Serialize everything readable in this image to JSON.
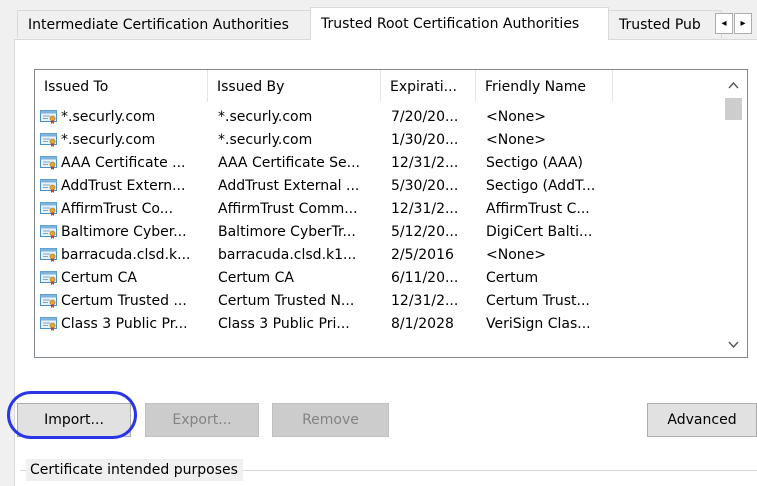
{
  "tabs": [
    {
      "label": "Intermediate Certification Authorities",
      "active": false
    },
    {
      "label": "Trusted Root Certification Authorities",
      "active": true
    },
    {
      "label": "Trusted Pub",
      "active": false
    }
  ],
  "tab_scroll": {
    "left": "◂",
    "right": "▸"
  },
  "list": {
    "columns": [
      "Issued To",
      "Issued By",
      "Expirati...",
      "Friendly Name"
    ],
    "rows": [
      [
        "*.securly.com",
        "*.securly.com",
        "7/20/20...",
        "<None>"
      ],
      [
        "*.securly.com",
        "*.securly.com",
        "1/30/20...",
        "<None>"
      ],
      [
        "AAA Certificate ...",
        "AAA Certificate Se...",
        "12/31/2...",
        "Sectigo (AAA)"
      ],
      [
        "AddTrust Extern...",
        "AddTrust External ...",
        "5/30/20...",
        "Sectigo (AddT..."
      ],
      [
        "AffirmTrust Co...",
        "AffirmTrust Comm...",
        "12/31/2...",
        "AffirmTrust C..."
      ],
      [
        "Baltimore Cyber...",
        "Baltimore CyberTr...",
        "5/12/20...",
        "DigiCert Balti..."
      ],
      [
        "barracuda.clsd.k...",
        "barracuda.clsd.k1...",
        "2/5/2016",
        "<None>"
      ],
      [
        "Certum CA",
        "Certum CA",
        "6/11/20...",
        "Certum"
      ],
      [
        "Certum Trusted ...",
        "Certum Trusted N...",
        "12/31/2...",
        "Certum Trust..."
      ],
      [
        "Class 3 Public Pr...",
        "Class 3 Public Pri...",
        "8/1/2028",
        "VeriSign Clas..."
      ]
    ],
    "scroll_up": "^",
    "scroll_down": "v"
  },
  "buttons": {
    "import": "Import...",
    "export": "Export...",
    "remove": "Remove",
    "advanced": "Advanced"
  },
  "group": {
    "label": "Certificate intended purposes"
  },
  "colors": {
    "annotation_circle": "#2b35e8",
    "icon_blue": "#4a90c8",
    "icon_ribbon": "#d89a2b"
  }
}
